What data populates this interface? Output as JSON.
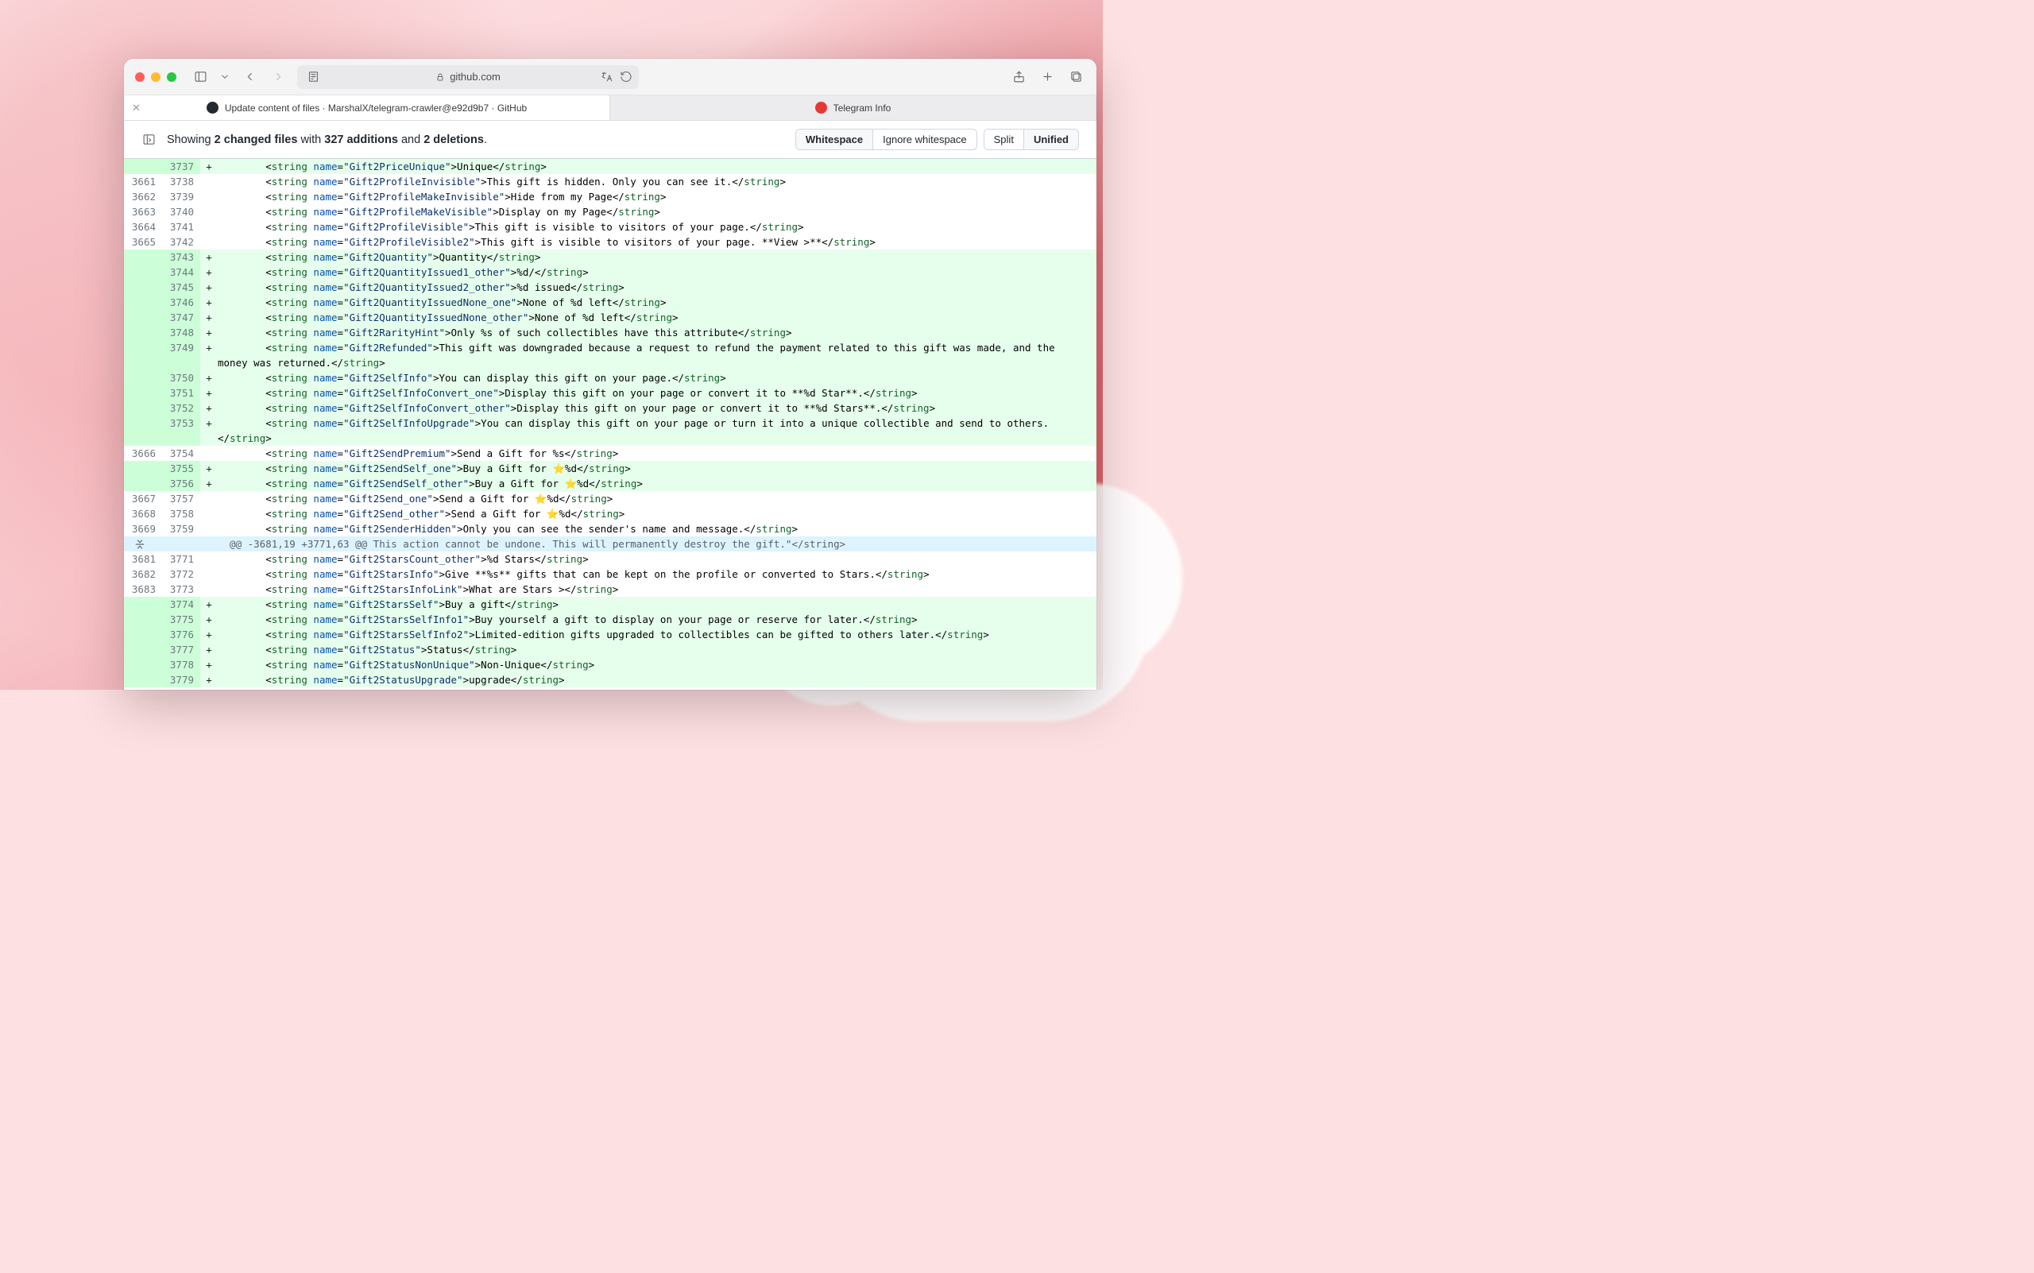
{
  "wallpaper_badge": "tginfo",
  "address_bar": {
    "host": "github.com"
  },
  "tabs": [
    {
      "label": "Update content of files · MarshalX/telegram-crawler@e92d9b7 · GitHub",
      "active": true,
      "favicon": "github"
    },
    {
      "label": "Telegram Info",
      "active": false,
      "favicon": "tg"
    }
  ],
  "summary": {
    "prefix": "Showing ",
    "changed_files": "2 changed files",
    "mid1": " with ",
    "additions": "327 additions",
    "mid2": " and ",
    "deletions": "2 deletions",
    "suffix": "."
  },
  "buttons": {
    "whitespace": "Whitespace",
    "ignore_ws": "Ignore whitespace",
    "split": "Split",
    "unified": "Unified"
  },
  "diff": [
    {
      "t": "add",
      "o": "",
      "n": "3737",
      "name": "Gift2PriceUnique",
      "text": "Unique"
    },
    {
      "t": "ctx",
      "o": "3661",
      "n": "3738",
      "name": "Gift2ProfileInvisible",
      "text": "This gift is hidden. Only you can see it."
    },
    {
      "t": "ctx",
      "o": "3662",
      "n": "3739",
      "name": "Gift2ProfileMakeInvisible",
      "text": "Hide from my Page"
    },
    {
      "t": "ctx",
      "o": "3663",
      "n": "3740",
      "name": "Gift2ProfileMakeVisible",
      "text": "Display on my Page"
    },
    {
      "t": "ctx",
      "o": "3664",
      "n": "3741",
      "name": "Gift2ProfileVisible",
      "text": "This gift is visible to visitors of your page."
    },
    {
      "t": "ctx",
      "o": "3665",
      "n": "3742",
      "name": "Gift2ProfileVisible2",
      "text": "This gift is visible to visitors of your page. **View >**"
    },
    {
      "t": "add",
      "o": "",
      "n": "3743",
      "name": "Gift2Quantity",
      "text": "Quantity"
    },
    {
      "t": "add",
      "o": "",
      "n": "3744",
      "name": "Gift2QuantityIssued1_other",
      "text": "%d/"
    },
    {
      "t": "add",
      "o": "",
      "n": "3745",
      "name": "Gift2QuantityIssued2_other",
      "text": "%d issued"
    },
    {
      "t": "add",
      "o": "",
      "n": "3746",
      "name": "Gift2QuantityIssuedNone_one",
      "text": "None of %d left"
    },
    {
      "t": "add",
      "o": "",
      "n": "3747",
      "name": "Gift2QuantityIssuedNone_other",
      "text": "None of %d left"
    },
    {
      "t": "add",
      "o": "",
      "n": "3748",
      "name": "Gift2RarityHint",
      "text": "Only %s of such collectibles have this attribute"
    },
    {
      "t": "add",
      "o": "",
      "n": "3749",
      "name": "Gift2Refunded",
      "text": "This gift was downgraded because a request to refund the payment related to this gift was made, and the money was returned.",
      "wrap": true
    },
    {
      "t": "add",
      "o": "",
      "n": "3750",
      "name": "Gift2SelfInfo",
      "text": "You can display this gift on your page."
    },
    {
      "t": "add",
      "o": "",
      "n": "3751",
      "name": "Gift2SelfInfoConvert_one",
      "text": "Display this gift on your page or convert it to **%d Star**."
    },
    {
      "t": "add",
      "o": "",
      "n": "3752",
      "name": "Gift2SelfInfoConvert_other",
      "text": "Display this gift on your page or convert it to **%d Stars**."
    },
    {
      "t": "add",
      "o": "",
      "n": "3753",
      "name": "Gift2SelfInfoUpgrade",
      "text": "You can display this gift on your page or turn it into a unique collectible and send to others.",
      "wrap": true
    },
    {
      "t": "ctx",
      "o": "3666",
      "n": "3754",
      "name": "Gift2SendPremium",
      "text": "Send a Gift for %s"
    },
    {
      "t": "add",
      "o": "",
      "n": "3755",
      "name": "Gift2SendSelf_one",
      "text": "Buy a Gift for ⭐️%d"
    },
    {
      "t": "add",
      "o": "",
      "n": "3756",
      "name": "Gift2SendSelf_other",
      "text": "Buy a Gift for ⭐️%d"
    },
    {
      "t": "ctx",
      "o": "3667",
      "n": "3757",
      "name": "Gift2Send_one",
      "text": "Send a Gift for ⭐️%d"
    },
    {
      "t": "ctx",
      "o": "3668",
      "n": "3758",
      "name": "Gift2Send_other",
      "text": "Send a Gift for ⭐️%d"
    },
    {
      "t": "ctx",
      "o": "3669",
      "n": "3759",
      "name": "Gift2SenderHidden",
      "text": "Only you can see the sender's name and message."
    },
    {
      "t": "hunk",
      "header": "@@ -3681,19 +3771,63 @@ This action cannot be undone. This will permanently destroy the gift.\"</string>"
    },
    {
      "t": "ctx",
      "o": "3681",
      "n": "3771",
      "name": "Gift2StarsCount_other",
      "text": "%d Stars"
    },
    {
      "t": "ctx",
      "o": "3682",
      "n": "3772",
      "name": "Gift2StarsInfo",
      "text": "Give **%s** gifts that can be kept on the profile or converted to Stars."
    },
    {
      "t": "ctx",
      "o": "3683",
      "n": "3773",
      "name": "Gift2StarsInfoLink",
      "text": "What are Stars >"
    },
    {
      "t": "add",
      "o": "",
      "n": "3774",
      "name": "Gift2StarsSelf",
      "text": "Buy a gift"
    },
    {
      "t": "add",
      "o": "",
      "n": "3775",
      "name": "Gift2StarsSelfInfo1",
      "text": "Buy yourself a gift to display on your page or reserve for later."
    },
    {
      "t": "add",
      "o": "",
      "n": "3776",
      "name": "Gift2StarsSelfInfo2",
      "text": "Limited-edition gifts upgraded to collectibles can be gifted to others later."
    },
    {
      "t": "add",
      "o": "",
      "n": "3777",
      "name": "Gift2Status",
      "text": "Status"
    },
    {
      "t": "add",
      "o": "",
      "n": "3778",
      "name": "Gift2StatusNonUnique",
      "text": "Non-Unique"
    },
    {
      "t": "add",
      "o": "",
      "n": "3779",
      "name": "Gift2StatusUpgrade",
      "text": "upgrade"
    }
  ]
}
